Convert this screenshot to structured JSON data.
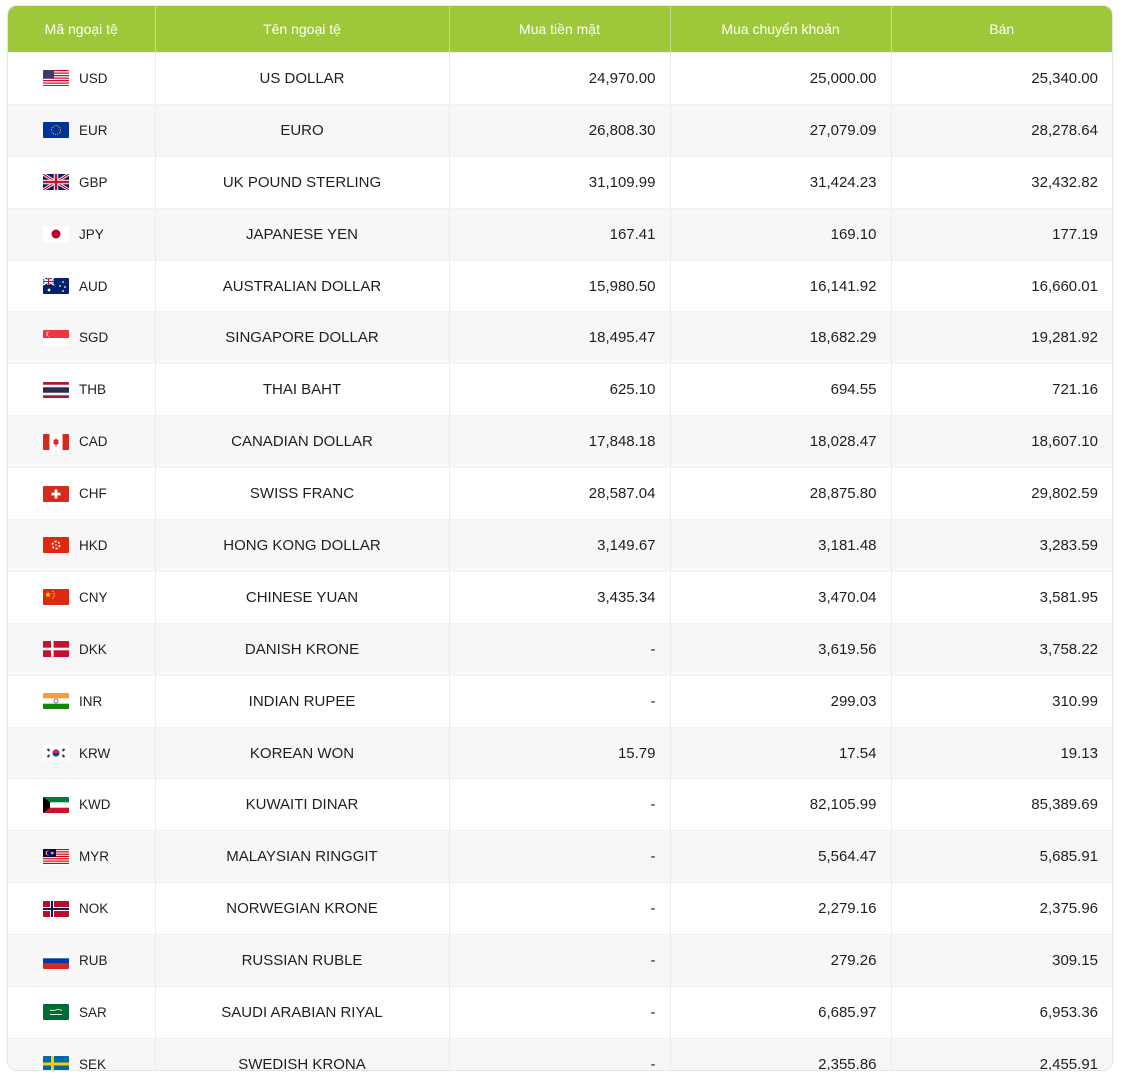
{
  "table": {
    "headers": [
      "Mã ngoại tệ",
      "Tên ngoại tệ",
      "Mua tiền mặt",
      "Mua chuyển khoản",
      "Bán"
    ],
    "rows": [
      {
        "code": "USD",
        "flag": "us-flag-icon",
        "name": "US DOLLAR",
        "cash": "24,970.00",
        "transfer": "25,000.00",
        "sell": "25,340.00"
      },
      {
        "code": "EUR",
        "flag": "eu-flag-icon",
        "name": "EURO",
        "cash": "26,808.30",
        "transfer": "27,079.09",
        "sell": "28,278.64"
      },
      {
        "code": "GBP",
        "flag": "gb-flag-icon",
        "name": "UK POUND STERLING",
        "cash": "31,109.99",
        "transfer": "31,424.23",
        "sell": "32,432.82"
      },
      {
        "code": "JPY",
        "flag": "jp-flag-icon",
        "name": "JAPANESE YEN",
        "cash": "167.41",
        "transfer": "169.10",
        "sell": "177.19"
      },
      {
        "code": "AUD",
        "flag": "au-flag-icon",
        "name": "AUSTRALIAN DOLLAR",
        "cash": "15,980.50",
        "transfer": "16,141.92",
        "sell": "16,660.01"
      },
      {
        "code": "SGD",
        "flag": "sg-flag-icon",
        "name": "SINGAPORE DOLLAR",
        "cash": "18,495.47",
        "transfer": "18,682.29",
        "sell": "19,281.92"
      },
      {
        "code": "THB",
        "flag": "th-flag-icon",
        "name": "THAI BAHT",
        "cash": "625.10",
        "transfer": "694.55",
        "sell": "721.16"
      },
      {
        "code": "CAD",
        "flag": "ca-flag-icon",
        "name": "CANADIAN DOLLAR",
        "cash": "17,848.18",
        "transfer": "18,028.47",
        "sell": "18,607.10"
      },
      {
        "code": "CHF",
        "flag": "ch-flag-icon",
        "name": "SWISS FRANC",
        "cash": "28,587.04",
        "transfer": "28,875.80",
        "sell": "29,802.59"
      },
      {
        "code": "HKD",
        "flag": "hk-flag-icon",
        "name": "HONG KONG DOLLAR",
        "cash": "3,149.67",
        "transfer": "3,181.48",
        "sell": "3,283.59"
      },
      {
        "code": "CNY",
        "flag": "cn-flag-icon",
        "name": "CHINESE YUAN",
        "cash": "3,435.34",
        "transfer": "3,470.04",
        "sell": "3,581.95"
      },
      {
        "code": "DKK",
        "flag": "dk-flag-icon",
        "name": "DANISH KRONE",
        "cash": "-",
        "transfer": "3,619.56",
        "sell": "3,758.22"
      },
      {
        "code": "INR",
        "flag": "in-flag-icon",
        "name": "INDIAN RUPEE",
        "cash": "-",
        "transfer": "299.03",
        "sell": "310.99"
      },
      {
        "code": "KRW",
        "flag": "kr-flag-icon",
        "name": "KOREAN WON",
        "cash": "15.79",
        "transfer": "17.54",
        "sell": "19.13"
      },
      {
        "code": "KWD",
        "flag": "kw-flag-icon",
        "name": "KUWAITI DINAR",
        "cash": "-",
        "transfer": "82,105.99",
        "sell": "85,389.69"
      },
      {
        "code": "MYR",
        "flag": "my-flag-icon",
        "name": "MALAYSIAN RINGGIT",
        "cash": "-",
        "transfer": "5,564.47",
        "sell": "5,685.91"
      },
      {
        "code": "NOK",
        "flag": "no-flag-icon",
        "name": "NORWEGIAN KRONE",
        "cash": "-",
        "transfer": "2,279.16",
        "sell": "2,375.96"
      },
      {
        "code": "RUB",
        "flag": "ru-flag-icon",
        "name": "RUSSIAN RUBLE",
        "cash": "-",
        "transfer": "279.26",
        "sell": "309.15"
      },
      {
        "code": "SAR",
        "flag": "sa-flag-icon",
        "name": "SAUDI ARABIAN RIYAL",
        "cash": "-",
        "transfer": "6,685.97",
        "sell": "6,953.36"
      },
      {
        "code": "SEK",
        "flag": "se-flag-icon",
        "name": "SWEDISH KRONA",
        "cash": "-",
        "transfer": "2,355.86",
        "sell": "2,455.91"
      }
    ]
  },
  "colors": {
    "header_bg": "#9fc73a",
    "header_text": "#ffffff",
    "row_alt": "#f7f7f7"
  }
}
